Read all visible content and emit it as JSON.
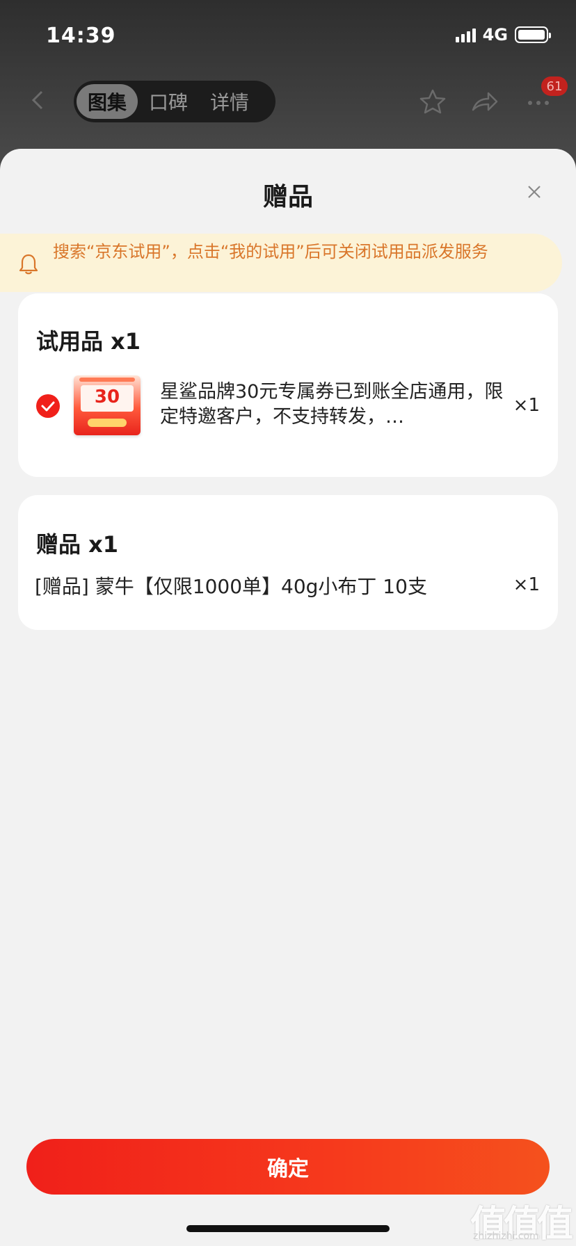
{
  "status_bar": {
    "time": "14:39",
    "network": "4G"
  },
  "nav": {
    "tabs": [
      {
        "label": "图集",
        "active": true
      },
      {
        "label": "口碑",
        "active": false
      },
      {
        "label": "详情",
        "active": false
      }
    ],
    "badge_count": "61",
    "icons": [
      "back-icon",
      "star-icon",
      "share-icon",
      "more-icon"
    ]
  },
  "sheet": {
    "title": "赠品",
    "notice": "搜索“京东试用”，点击“我的试用”后可关闭试用品派发服务",
    "trial": {
      "heading": "试用品 x1",
      "checked": true,
      "coupon_amount": "30",
      "description": "星鲨品牌30元专属券已到账全店通用，限定特邀客户，不支持转发，…",
      "quantity": "×1"
    },
    "gift": {
      "heading": "赠品 x1",
      "name": "[赠品] 蒙牛【仅限1000单】40g小布丁 10支",
      "quantity": "×1"
    },
    "confirm_label": "确定"
  },
  "watermark": {
    "chars": "值值值",
    "url": "zhizhizhi.com"
  },
  "colors": {
    "accent_red": "#f0201a",
    "notice_bg": "#fcf3d7",
    "notice_text": "#d9762a",
    "sheet_bg": "#f2f2f2"
  }
}
